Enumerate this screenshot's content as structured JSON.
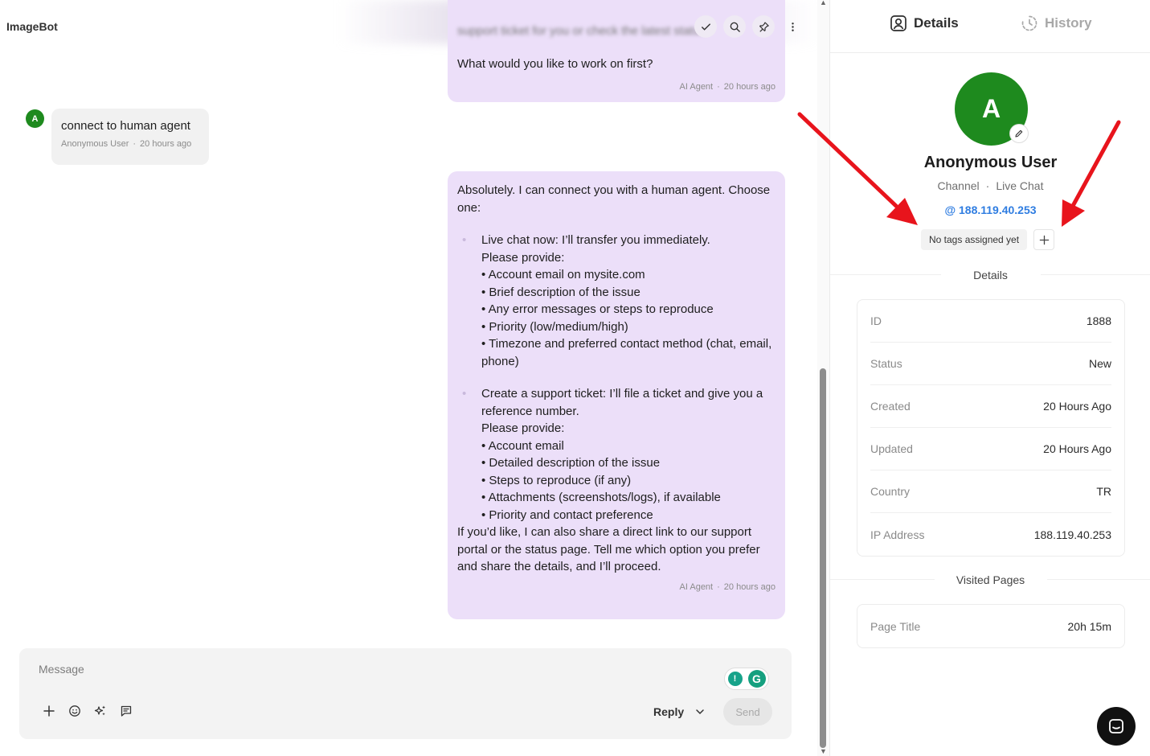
{
  "app": {
    "title": "ImageBot"
  },
  "chat": {
    "top_message": {
      "question": "What would you like to work on first?",
      "author": "AI Agent",
      "time": "20 hours ago",
      "blurred_text": "support ticket for you or check the latest status"
    },
    "user_message": {
      "avatar_letter": "A",
      "text": "connect to human agent",
      "author": "Anonymous User",
      "time": "20 hours ago"
    },
    "agent_message": {
      "intro": "Absolutely. I can connect you with a human agent. Choose one:",
      "option1_title": "Live chat now: I’ll transfer you immediately.",
      "option1_provide": "Please provide:",
      "option1_items": [
        "• Account email on mysite.com",
        "• Brief description of the issue",
        "• Any error messages or steps to reproduce",
        "• Priority (low/medium/high)",
        "• Timezone and preferred contact method (chat, email, phone)"
      ],
      "option2_title": "Create a support ticket: I’ll file a ticket and give you a reference number.",
      "option2_provide": "Please provide:",
      "option2_items": [
        "• Account email",
        "• Detailed description of the issue",
        "• Steps to reproduce (if any)",
        "• Attachments (screenshots/logs), if available",
        "• Priority and contact preference"
      ],
      "closing": "If you’d like, I can also share a direct link to our support portal or the status page. Tell me which option you prefer and share the details, and I’ll proceed.",
      "author": "AI Agent",
      "time": "20 hours ago"
    },
    "composer": {
      "placeholder": "Message",
      "reply_label": "Reply",
      "send_label": "Send"
    }
  },
  "panel": {
    "tabs": {
      "details": "Details",
      "history": "History"
    },
    "profile": {
      "avatar_letter": "A",
      "name": "Anonymous User",
      "channel_label": "Channel",
      "channel_value": "Live Chat",
      "ip": "@ 188.119.40.253",
      "tags_empty": "No tags assigned yet"
    },
    "details_title": "Details",
    "details": [
      {
        "k": "ID",
        "v": "1888"
      },
      {
        "k": "Status",
        "v": "New"
      },
      {
        "k": "Created",
        "v": "20 Hours Ago"
      },
      {
        "k": "Updated",
        "v": "20 Hours Ago"
      },
      {
        "k": "Country",
        "v": "TR"
      },
      {
        "k": "IP Address",
        "v": "188.119.40.253"
      }
    ],
    "visited_title": "Visited Pages",
    "visited": [
      {
        "k": "Page Title",
        "v": "20h 15m"
      }
    ]
  },
  "colors": {
    "avatar": "#1e8a1e",
    "ai_bubble": "#ecdff9",
    "link": "#2f7de1",
    "arrow": "#e8141c"
  }
}
